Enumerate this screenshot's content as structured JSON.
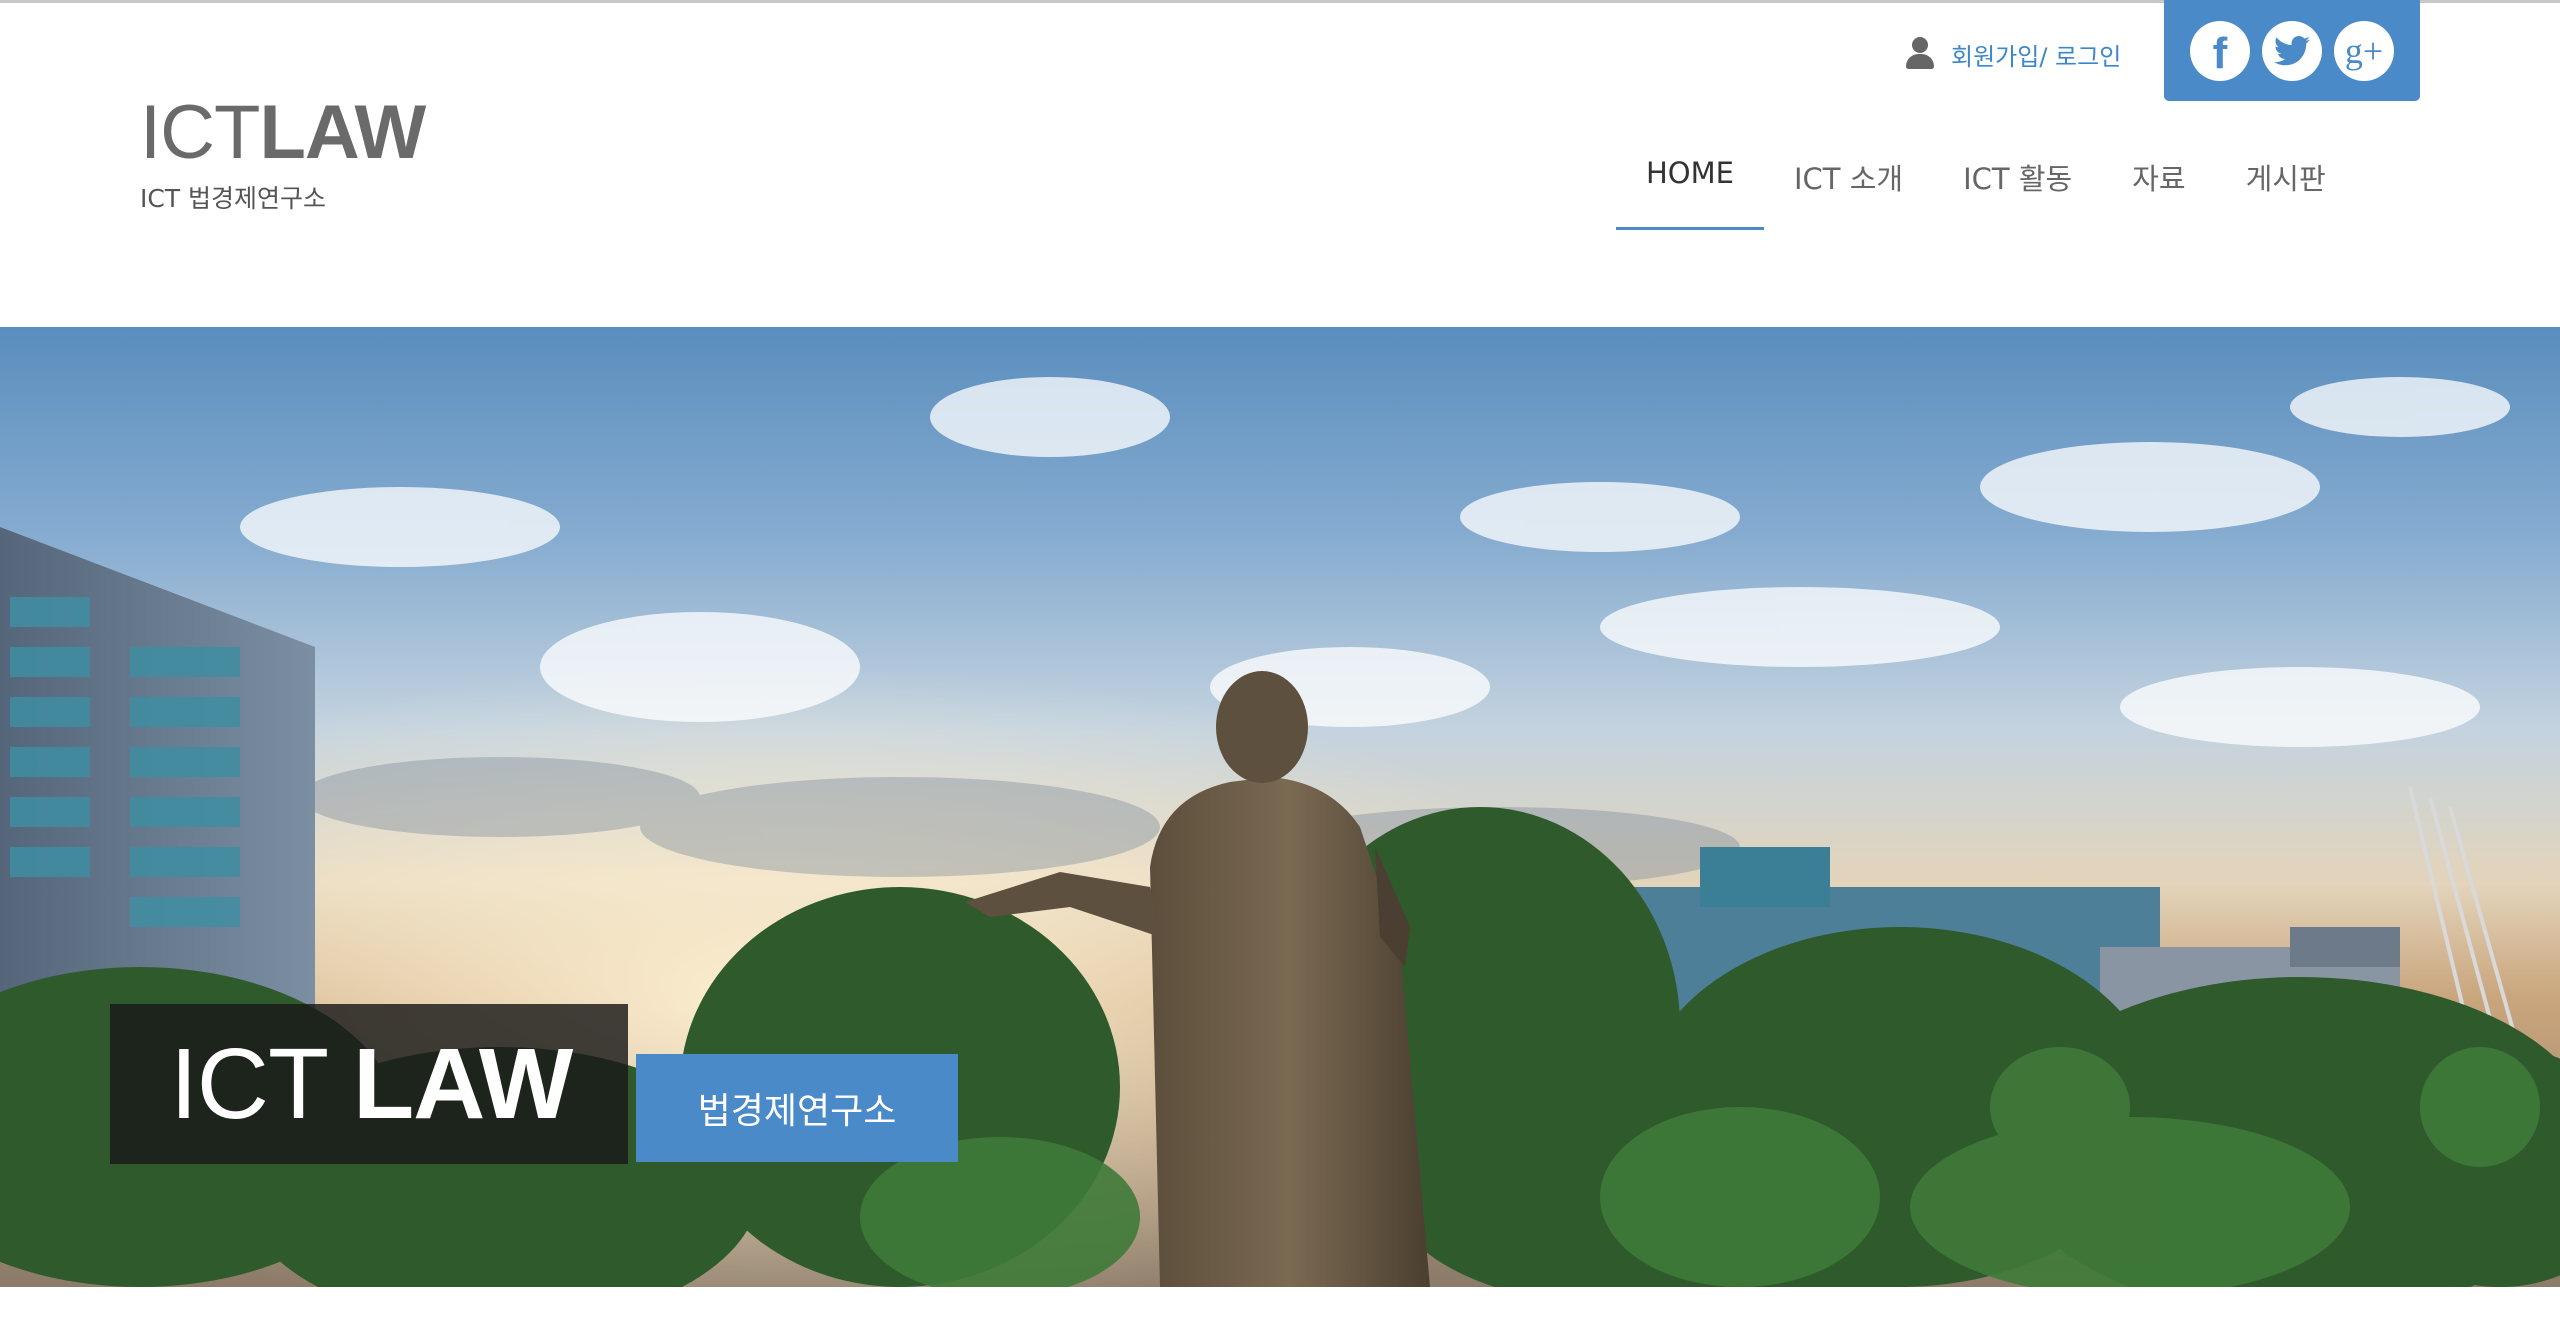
{
  "header": {
    "logo": {
      "main_light": "ICT",
      "main_bold": "LAW",
      "subtitle": "ICT 법경제연구소"
    },
    "member": {
      "icon": "user-icon",
      "label": "회원가입/ 로그인"
    },
    "social": [
      {
        "name": "facebook",
        "glyph": "f"
      },
      {
        "name": "twitter",
        "glyph": "twitter-bird"
      },
      {
        "name": "google-plus",
        "glyph": "g+"
      }
    ]
  },
  "nav": {
    "active_index": 0,
    "items": [
      {
        "label": "HOME"
      },
      {
        "label": "ICT 소개"
      },
      {
        "label": "ICT 활동"
      },
      {
        "label": "자료"
      },
      {
        "label": "게시판"
      }
    ]
  },
  "hero": {
    "title_light": "ICT",
    "title_bold": "LAW",
    "subtitle_button": "법경제연구소"
  },
  "colors": {
    "accent": "#4a8ac8",
    "logo_text": "#6a6a6a",
    "nav_text": "#666666",
    "hero_title_bg": "#191919"
  }
}
